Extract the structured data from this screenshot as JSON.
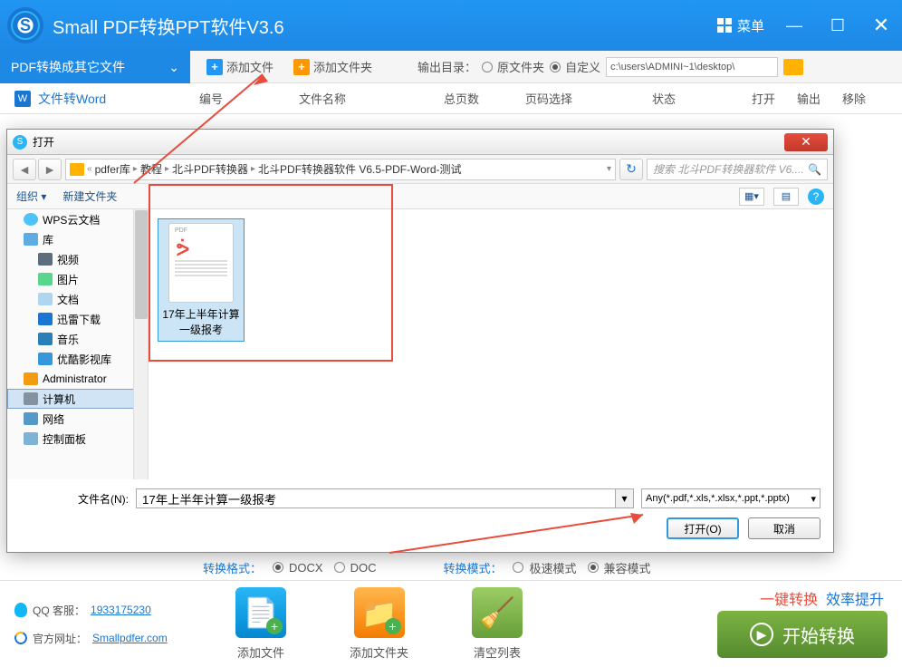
{
  "titlebar": {
    "title": "Small  PDF转换PPT软件V3.6",
    "logo_letter": "S",
    "menu": "菜单"
  },
  "tabbar": {
    "dropdown": "PDF转换成其它文件",
    "add_file": "添加文件",
    "add_folder": "添加文件夹",
    "output_label": "输出目录：",
    "radio_src": "原文件夹",
    "radio_custom": "自定义",
    "path": "c:\\users\\ADMINI~1\\desktop\\"
  },
  "sidebar": {
    "word": "文件转Word"
  },
  "cols": {
    "c1": "编号",
    "c2": "文件名称",
    "c3": "总页数",
    "c4": "页码选择",
    "c5": "状态",
    "c6": "打开",
    "c7": "输出",
    "c8": "移除"
  },
  "dialog": {
    "title": "打开",
    "breadcrumb": [
      "pdfer库",
      "教程",
      "北斗PDF转换器",
      "北斗PDF转换器软件 V6.5-PDF-Word-测试"
    ],
    "search_placeholder": "搜索 北斗PDF转换器软件 V6....",
    "organize": "组织 ▾",
    "newfolder": "新建文件夹",
    "tree": [
      {
        "icon": "cloud",
        "label": "WPS云文档"
      },
      {
        "icon": "lib",
        "label": "库"
      },
      {
        "icon": "vid",
        "label": "视频",
        "indent": true
      },
      {
        "icon": "img",
        "label": "图片",
        "indent": true
      },
      {
        "icon": "doc",
        "label": "文档",
        "indent": true
      },
      {
        "icon": "dl",
        "label": "迅雷下载",
        "indent": true
      },
      {
        "icon": "mus",
        "label": "音乐",
        "indent": true
      },
      {
        "icon": "youku",
        "label": "优酷影视库",
        "indent": true
      },
      {
        "icon": "admin",
        "label": "Administrator"
      },
      {
        "icon": "comp",
        "label": "计算机",
        "selected": true
      },
      {
        "icon": "net",
        "label": "网络"
      },
      {
        "icon": "cp",
        "label": "控制面板"
      }
    ],
    "file_name": "17年上半年计算一级报考",
    "fn_label": "文件名(N):",
    "filter": "Any(*.pdf,*.xls,*.xlsx,*.ppt,*.pptx)",
    "open": "打开(O)",
    "cancel": "取消"
  },
  "opts": {
    "format_label": "转换格式：",
    "docx": "DOCX",
    "doc": "DOC",
    "mode_label": "转换模式：",
    "fast": "极速模式",
    "compat": "兼容模式"
  },
  "links": {
    "qq_label": "QQ 客服：",
    "qq": "1933175230",
    "site_label": "官方网址：",
    "site": "Smallpdfer.com"
  },
  "bigbtns": {
    "add_file": "添加文件",
    "add_folder": "添加文件夹",
    "clear": "清空列表"
  },
  "slogan": {
    "s1": "一键转换",
    "s2": "效率提升"
  },
  "start": "开始转换"
}
